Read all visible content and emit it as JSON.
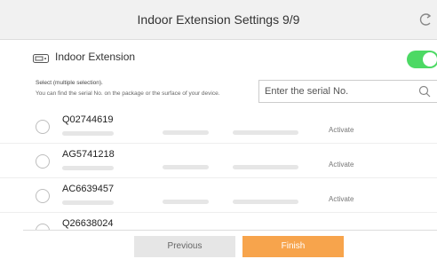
{
  "header": {
    "title": "Indoor Extension Settings 9/9",
    "refresh_icon": "refresh-icon"
  },
  "section": {
    "icon": "indoor-extension-icon",
    "label": "Indoor Extension",
    "toggle_on": true,
    "toggle_color": "#4cd964"
  },
  "instructions": {
    "line1": "Select (multiple selection).",
    "line2": "You can find the serial No. on the package or the surface of your device."
  },
  "search": {
    "placeholder": "Enter the serial No.",
    "icon": "search-icon"
  },
  "devices": [
    {
      "serial": "Q02744619",
      "status": "Activate"
    },
    {
      "serial": "AG5741218",
      "status": "Activate"
    },
    {
      "serial": "AC6639457",
      "status": "Activate"
    },
    {
      "serial": "Q26638024",
      "status": ""
    }
  ],
  "footer": {
    "previous_label": "Previous",
    "finish_label": "Finish",
    "finish_color": "#f7a44c"
  }
}
